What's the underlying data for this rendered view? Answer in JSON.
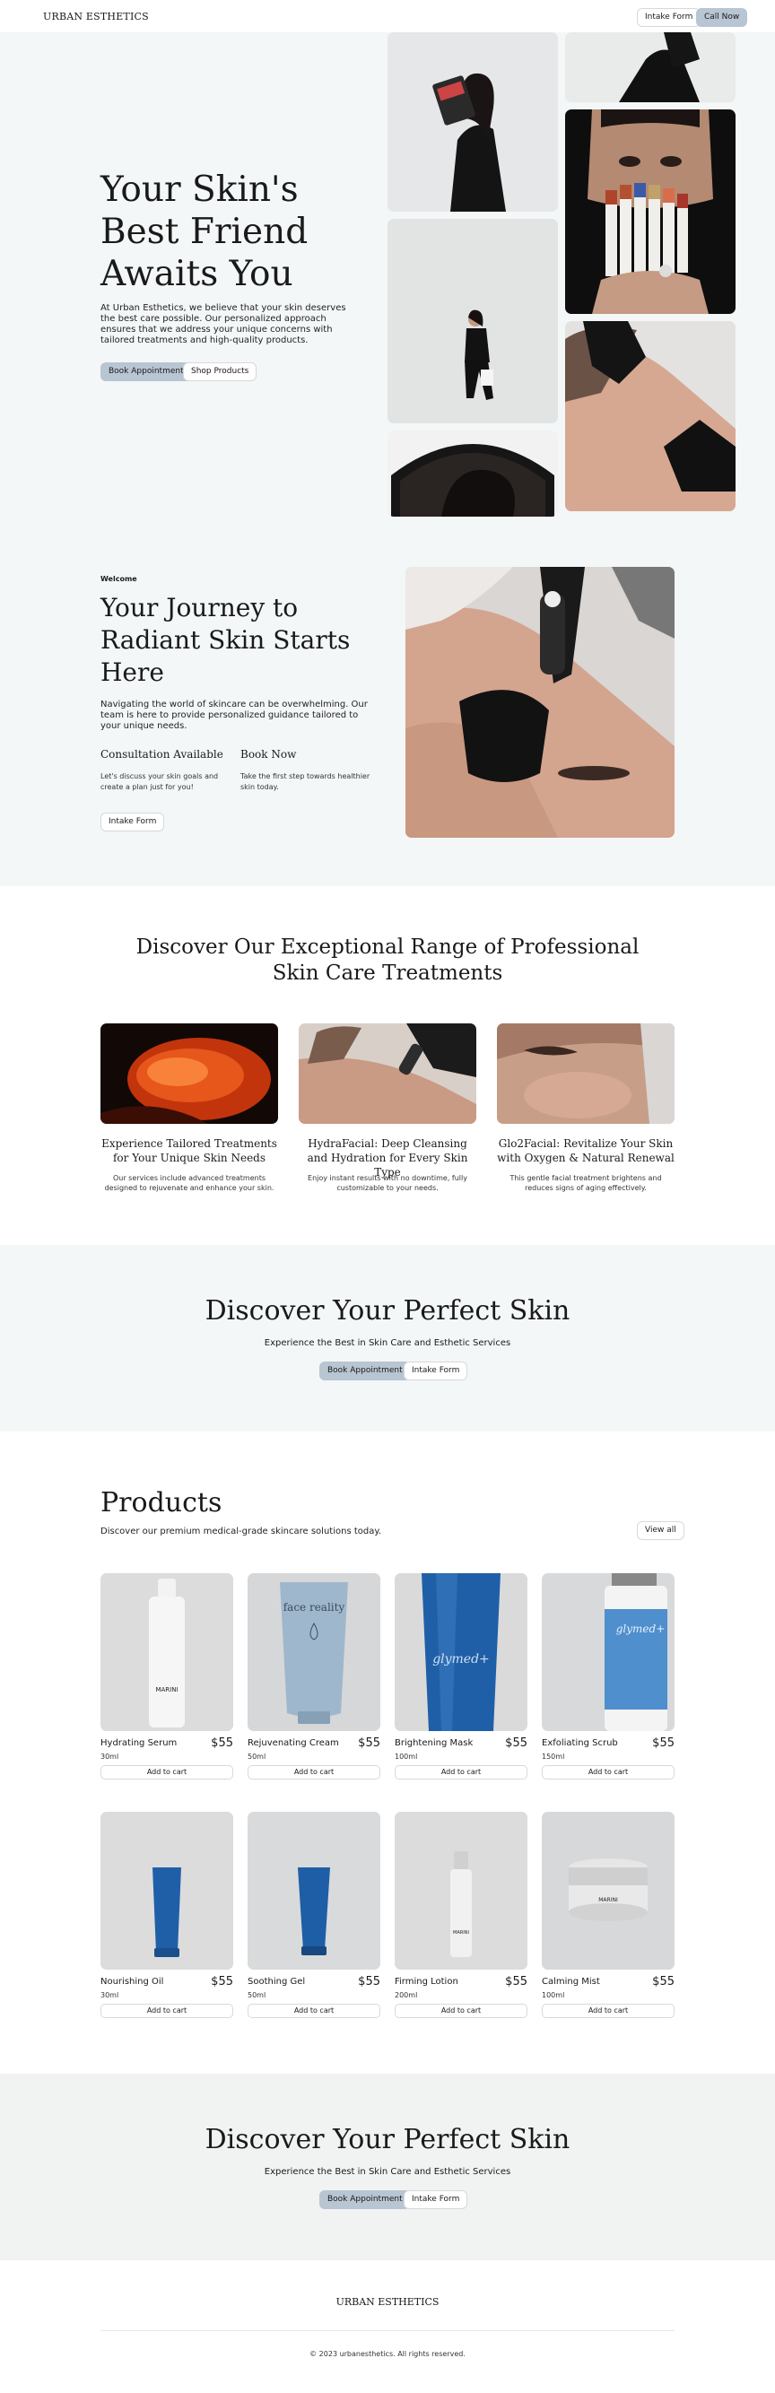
{
  "header": {
    "logo": "URBAN ESTHETICS",
    "intake_label": "Intake Form",
    "call_label": "Call Now"
  },
  "hero": {
    "title": "Your Skin's Best Friend Awaits You",
    "description": "At Urban Esthetics, we believe that your skin deserves the best care possible. Our personalized approach ensures that we address your unique concerns with tailored treatments and high-quality products.",
    "book_label": "Book Appointment",
    "shop_label": "Shop Products"
  },
  "journey": {
    "eyebrow": "Welcome",
    "title": "Your Journey to Radiant Skin Starts Here",
    "description": "Navigating the world of skincare can be overwhelming. Our team is here to provide personalized guidance tailored to your unique needs.",
    "col1_title": "Consultation Available",
    "col1_text": "Let's discuss your skin goals and create a plan just for you!",
    "col2_title": "Book Now",
    "col2_text": "Take the first step towards healthier skin today.",
    "intake_label": "Intake Form"
  },
  "treatments": {
    "title": "Discover Our Exceptional Range of Professional Skin Care Treatments",
    "cards": [
      {
        "title": "Experience Tailored Treatments for Your Unique Skin Needs",
        "text": "Our services include advanced treatments designed to rejuvenate and enhance your skin."
      },
      {
        "title": "HydraFacial: Deep Cleansing and Hydration for Every Skin Type",
        "text": "Enjoy instant results with no downtime, fully customizable to your needs."
      },
      {
        "title": "Glo2Facial: Revitalize Your Skin with Oxygen & Natural Renewal",
        "text": "This gentle facial treatment brightens and reduces signs of aging effectively."
      }
    ]
  },
  "cta": {
    "title": "Discover Your Perfect Skin",
    "subtitle": "Experience the Best in Skin Care and Esthetic Services",
    "book_label": "Book Appointment",
    "intake_label": "Intake Form"
  },
  "products": {
    "title": "Products",
    "subtitle": "Discover our premium medical-grade skincare solutions today.",
    "view_all": "View all",
    "add_label": "Add to cart",
    "items": [
      {
        "name": "Hydrating Serum",
        "price": "$55",
        "size": "30ml",
        "label": "MARINI"
      },
      {
        "name": "Rejuvenating Cream",
        "price": "$55",
        "size": "50ml",
        "label": "face reality"
      },
      {
        "name": "Brightening Mask",
        "price": "$55",
        "size": "100ml",
        "label": "glymed+"
      },
      {
        "name": "Exfoliating Scrub",
        "price": "$55",
        "size": "150ml",
        "label": "glymed+"
      },
      {
        "name": "Nourishing Oil",
        "price": "$55",
        "size": "30ml",
        "label": ""
      },
      {
        "name": "Soothing Gel",
        "price": "$55",
        "size": "50ml",
        "label": ""
      },
      {
        "name": "Firming Lotion",
        "price": "$55",
        "size": "200ml",
        "label": "MARINI"
      },
      {
        "name": "Calming Mist",
        "price": "$55",
        "size": "100ml",
        "label": "MARINI"
      }
    ]
  },
  "footer": {
    "logo": "URBAN ESTHETICS",
    "copyright": "© 2023 urbanesthetics. All rights reserved."
  },
  "colors": {
    "accent": "#b8c5d2",
    "section_bg": "#f4f7f7",
    "cta_bg_2": "#f1f2f2",
    "bottle_blue": "#1f5fa8"
  }
}
